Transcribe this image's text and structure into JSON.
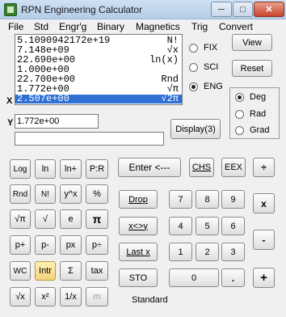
{
  "window": {
    "title": "RPN Engineering Calculator",
    "minimize": "─",
    "maximize": "□",
    "close": "✕"
  },
  "menu": [
    "File",
    "Std",
    "Engr'g",
    "Binary",
    "Magnetics",
    "Trig",
    "Convert"
  ],
  "stack": [
    {
      "value": "5.1090942172e+19",
      "label": "N!"
    },
    {
      "value": "7.148e+09",
      "label": "√x"
    },
    {
      "value": "22.690e+00",
      "label": "ln(x)"
    },
    {
      "value": "1.000e+00",
      "label": ""
    },
    {
      "value": "22.700e+00",
      "label": "Rnd"
    },
    {
      "value": "1.772e+00",
      "label": "√π"
    },
    {
      "value": "2.507e+00",
      "label": "√2π"
    }
  ],
  "x_label": "X",
  "y_label": "Y",
  "y_value": "1.772e+00",
  "entry_value": "",
  "format": {
    "options": [
      "FIX",
      "SCI",
      "ENG"
    ],
    "selected": "ENG"
  },
  "angle": {
    "options": [
      "Deg",
      "Rad",
      "Grad"
    ],
    "selected": "Deg"
  },
  "buttons": {
    "view": "View",
    "reset": "Reset",
    "display": "Display(3)",
    "log": "Log",
    "ln": "ln",
    "lnplus": "ln+",
    "pr": "P:R",
    "rnd": "Rnd",
    "nfact": "N!",
    "ypowx": "y^x",
    "pct": "%",
    "sqrtpi": "√π",
    "sqrt": "√",
    "e": "e",
    "pi": "π",
    "pplus": "p+",
    "pminus": "p-",
    "px": "px",
    "pdiv": "p÷",
    "wc": "WC",
    "intr": "Intr",
    "sigma": "Σ",
    "tax": "tax",
    "sqrtx": "√x",
    "xsq": "x²",
    "recip": "1/x",
    "m": "m",
    "enter": "Enter <---",
    "chs": "CHS",
    "eex": "EEX",
    "div": "÷",
    "drop": "Drop",
    "swap": "x<>y",
    "lastx": "Last x",
    "sto": "STO",
    "d7": "7",
    "d8": "8",
    "d9": "9",
    "mul": "x",
    "d4": "4",
    "d5": "5",
    "d6": "6",
    "sub": "-",
    "d1": "1",
    "d2": "2",
    "d3": "3",
    "d0": "0",
    "dot": ".",
    "add": "+"
  },
  "status": "Standard"
}
